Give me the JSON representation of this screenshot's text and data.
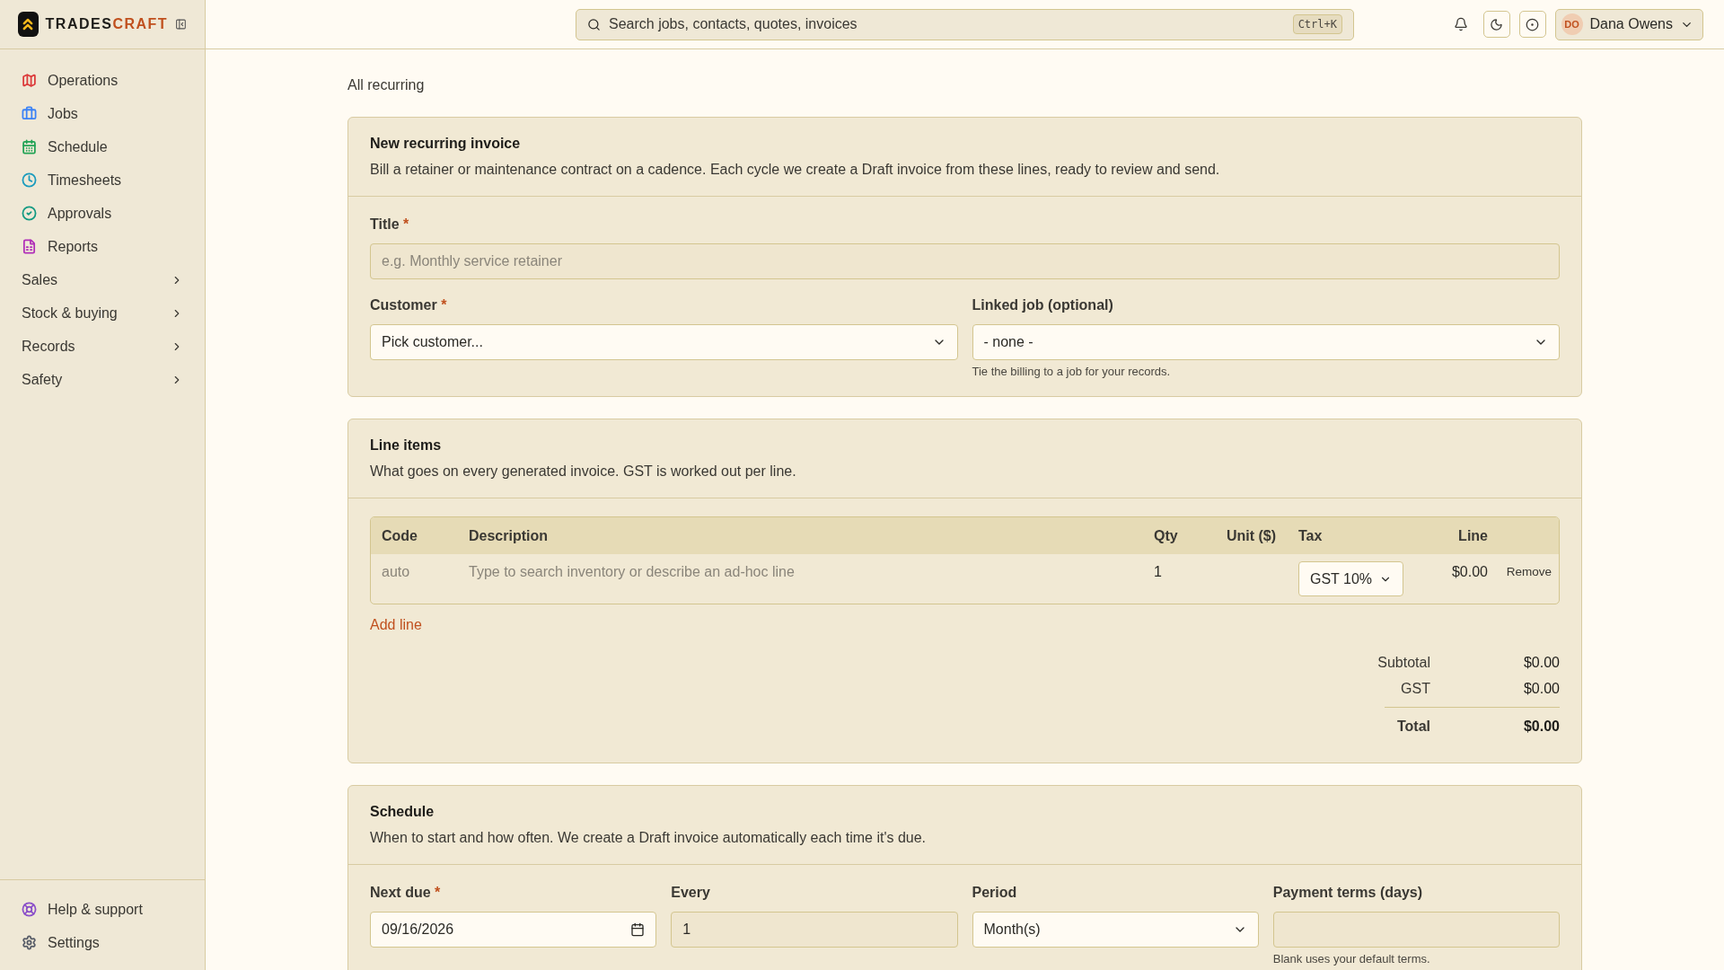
{
  "brand": {
    "first": "TRADES",
    "second": "CRAFT"
  },
  "search": {
    "placeholder": "Search jobs, contacts, quotes, invoices",
    "shortcut": "Ctrl+K"
  },
  "user": {
    "initials": "DO",
    "name": "Dana Owens"
  },
  "sidebar": {
    "items": [
      {
        "kind": "link",
        "label": "Operations",
        "color": "#dc3b3b"
      },
      {
        "kind": "link",
        "label": "Jobs",
        "color": "#3b82f6"
      },
      {
        "kind": "link",
        "label": "Schedule",
        "color": "#22a355"
      },
      {
        "kind": "link",
        "label": "Timesheets",
        "color": "#1a9bbd"
      },
      {
        "kind": "link",
        "label": "Approvals",
        "color": "#129a82"
      },
      {
        "kind": "link",
        "label": "Reports",
        "color": "#b02eb8"
      },
      {
        "kind": "group",
        "label": "Sales"
      },
      {
        "kind": "group",
        "label": "Stock & buying"
      },
      {
        "kind": "group",
        "label": "Records"
      },
      {
        "kind": "group",
        "label": "Safety"
      }
    ],
    "footer": [
      {
        "label": "Help & support",
        "color": "#8b4fc9"
      },
      {
        "label": "Settings",
        "color": "#555a66"
      }
    ]
  },
  "breadcrumb": "All recurring",
  "required_mark": "*",
  "details": {
    "title": "New recurring invoice",
    "description": "Bill a retainer or maintenance contract on a cadence. Each cycle we create a Draft invoice from these lines, ready to review and send.",
    "title_field": {
      "label": "Title",
      "required": true,
      "placeholder": "e.g. Monthly service retainer"
    },
    "customer": {
      "label": "Customer",
      "required": true,
      "value": "Pick customer..."
    },
    "linked_job": {
      "label": "Linked job (optional)",
      "value": "- none -",
      "hint": "Tie the billing to a job for your records."
    }
  },
  "line_items": {
    "title": "Line items",
    "description": "What goes on every generated invoice. GST is worked out per line.",
    "columns": [
      "Code",
      "Description",
      "Qty",
      "Unit ($)",
      "Tax",
      "Line"
    ],
    "rows": [
      {
        "code": "auto",
        "description_placeholder": "Type to search inventory or describe an ad-hoc line",
        "qty": "1",
        "tax": "GST 10%",
        "line": "$0.00",
        "remove": "Remove"
      }
    ],
    "add_line": "Add line",
    "totals": [
      {
        "kind": "normal",
        "label": "Subtotal",
        "value": "$0.00"
      },
      {
        "kind": "normal",
        "label": "GST",
        "value": "$0.00"
      },
      {
        "kind": "total",
        "label": "Total",
        "value": "$0.00"
      }
    ]
  },
  "schedule": {
    "title": "Schedule",
    "description": "When to start and how often. We create a Draft invoice automatically each time it's due.",
    "fields": [
      {
        "kind": "date",
        "label": "Next due",
        "required": true,
        "value": "09/16/2026"
      },
      {
        "kind": "input",
        "label": "Every",
        "value": "1"
      },
      {
        "kind": "select",
        "label": "Period",
        "value": "Month(s)"
      },
      {
        "kind": "input",
        "label": "Payment terms (days)",
        "hint": "Blank uses your default terms."
      }
    ]
  }
}
